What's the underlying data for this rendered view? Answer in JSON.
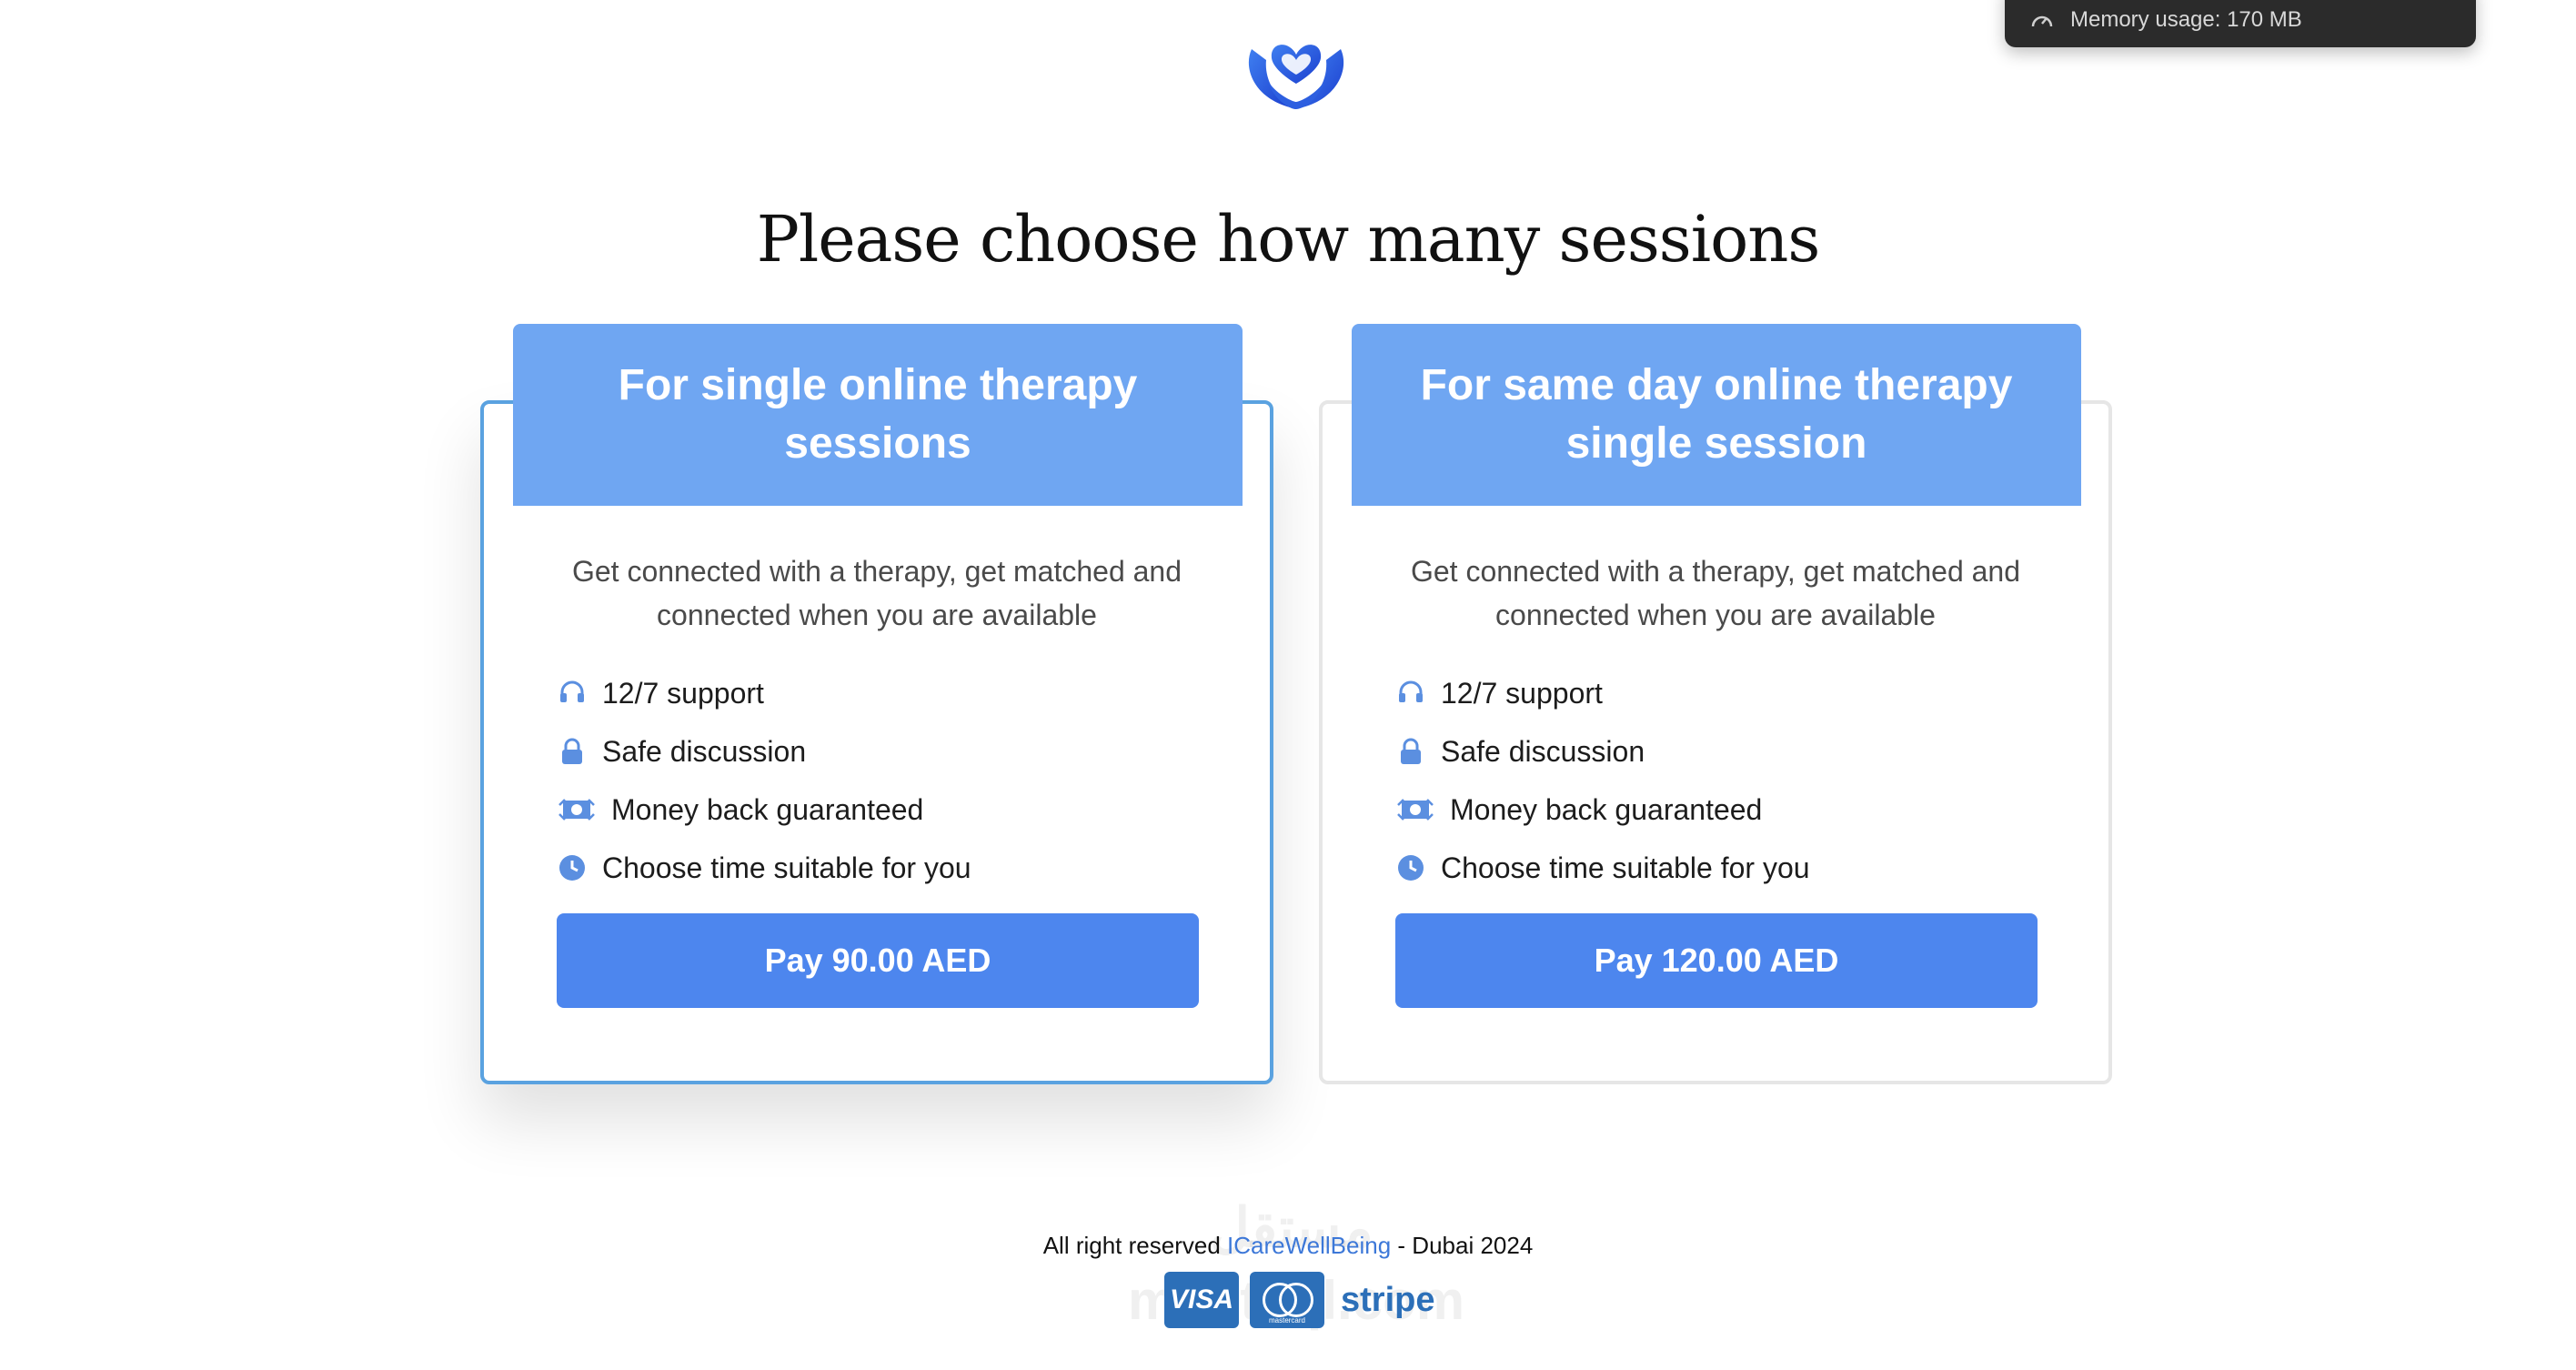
{
  "memory": {
    "text": "Memory usage: 170 MB"
  },
  "heading": "Please choose how many sessions",
  "cards": [
    {
      "title": "For single online therapy sessions",
      "description": "Get connected with a therapy, get matched and connected when you are available",
      "features": [
        "12/7 support",
        "Safe discussion",
        "Money back guaranteed",
        "Choose time suitable for you"
      ],
      "pay_label": "Pay 90.00 AED",
      "selected": true
    },
    {
      "title": "For same day online therapy single session",
      "description": "Get connected with a therapy, get matched and connected when you are available",
      "features": [
        "12/7 support",
        "Safe discussion",
        "Money back guaranteed",
        "Choose time suitable for you"
      ],
      "pay_label": "Pay 120.00 AED",
      "selected": false
    }
  ],
  "footer": {
    "prefix": "All right reserved ",
    "brand": "ICareWellBeing",
    "suffix": " - Dubai 2024"
  },
  "payment_methods": [
    "VISA",
    "mastercard",
    "stripe"
  ],
  "watermark": "مستقل mostaql.com",
  "colors": {
    "accent": "#4d86ee",
    "card_header": "#6fa6f2",
    "selected_border": "#5aa2e0",
    "icon": "#5b8fe0"
  },
  "icons": [
    "logo-heart-hands-icon",
    "speedometer-icon",
    "headset-icon",
    "lock-icon",
    "money-exchange-icon",
    "clock-icon"
  ]
}
